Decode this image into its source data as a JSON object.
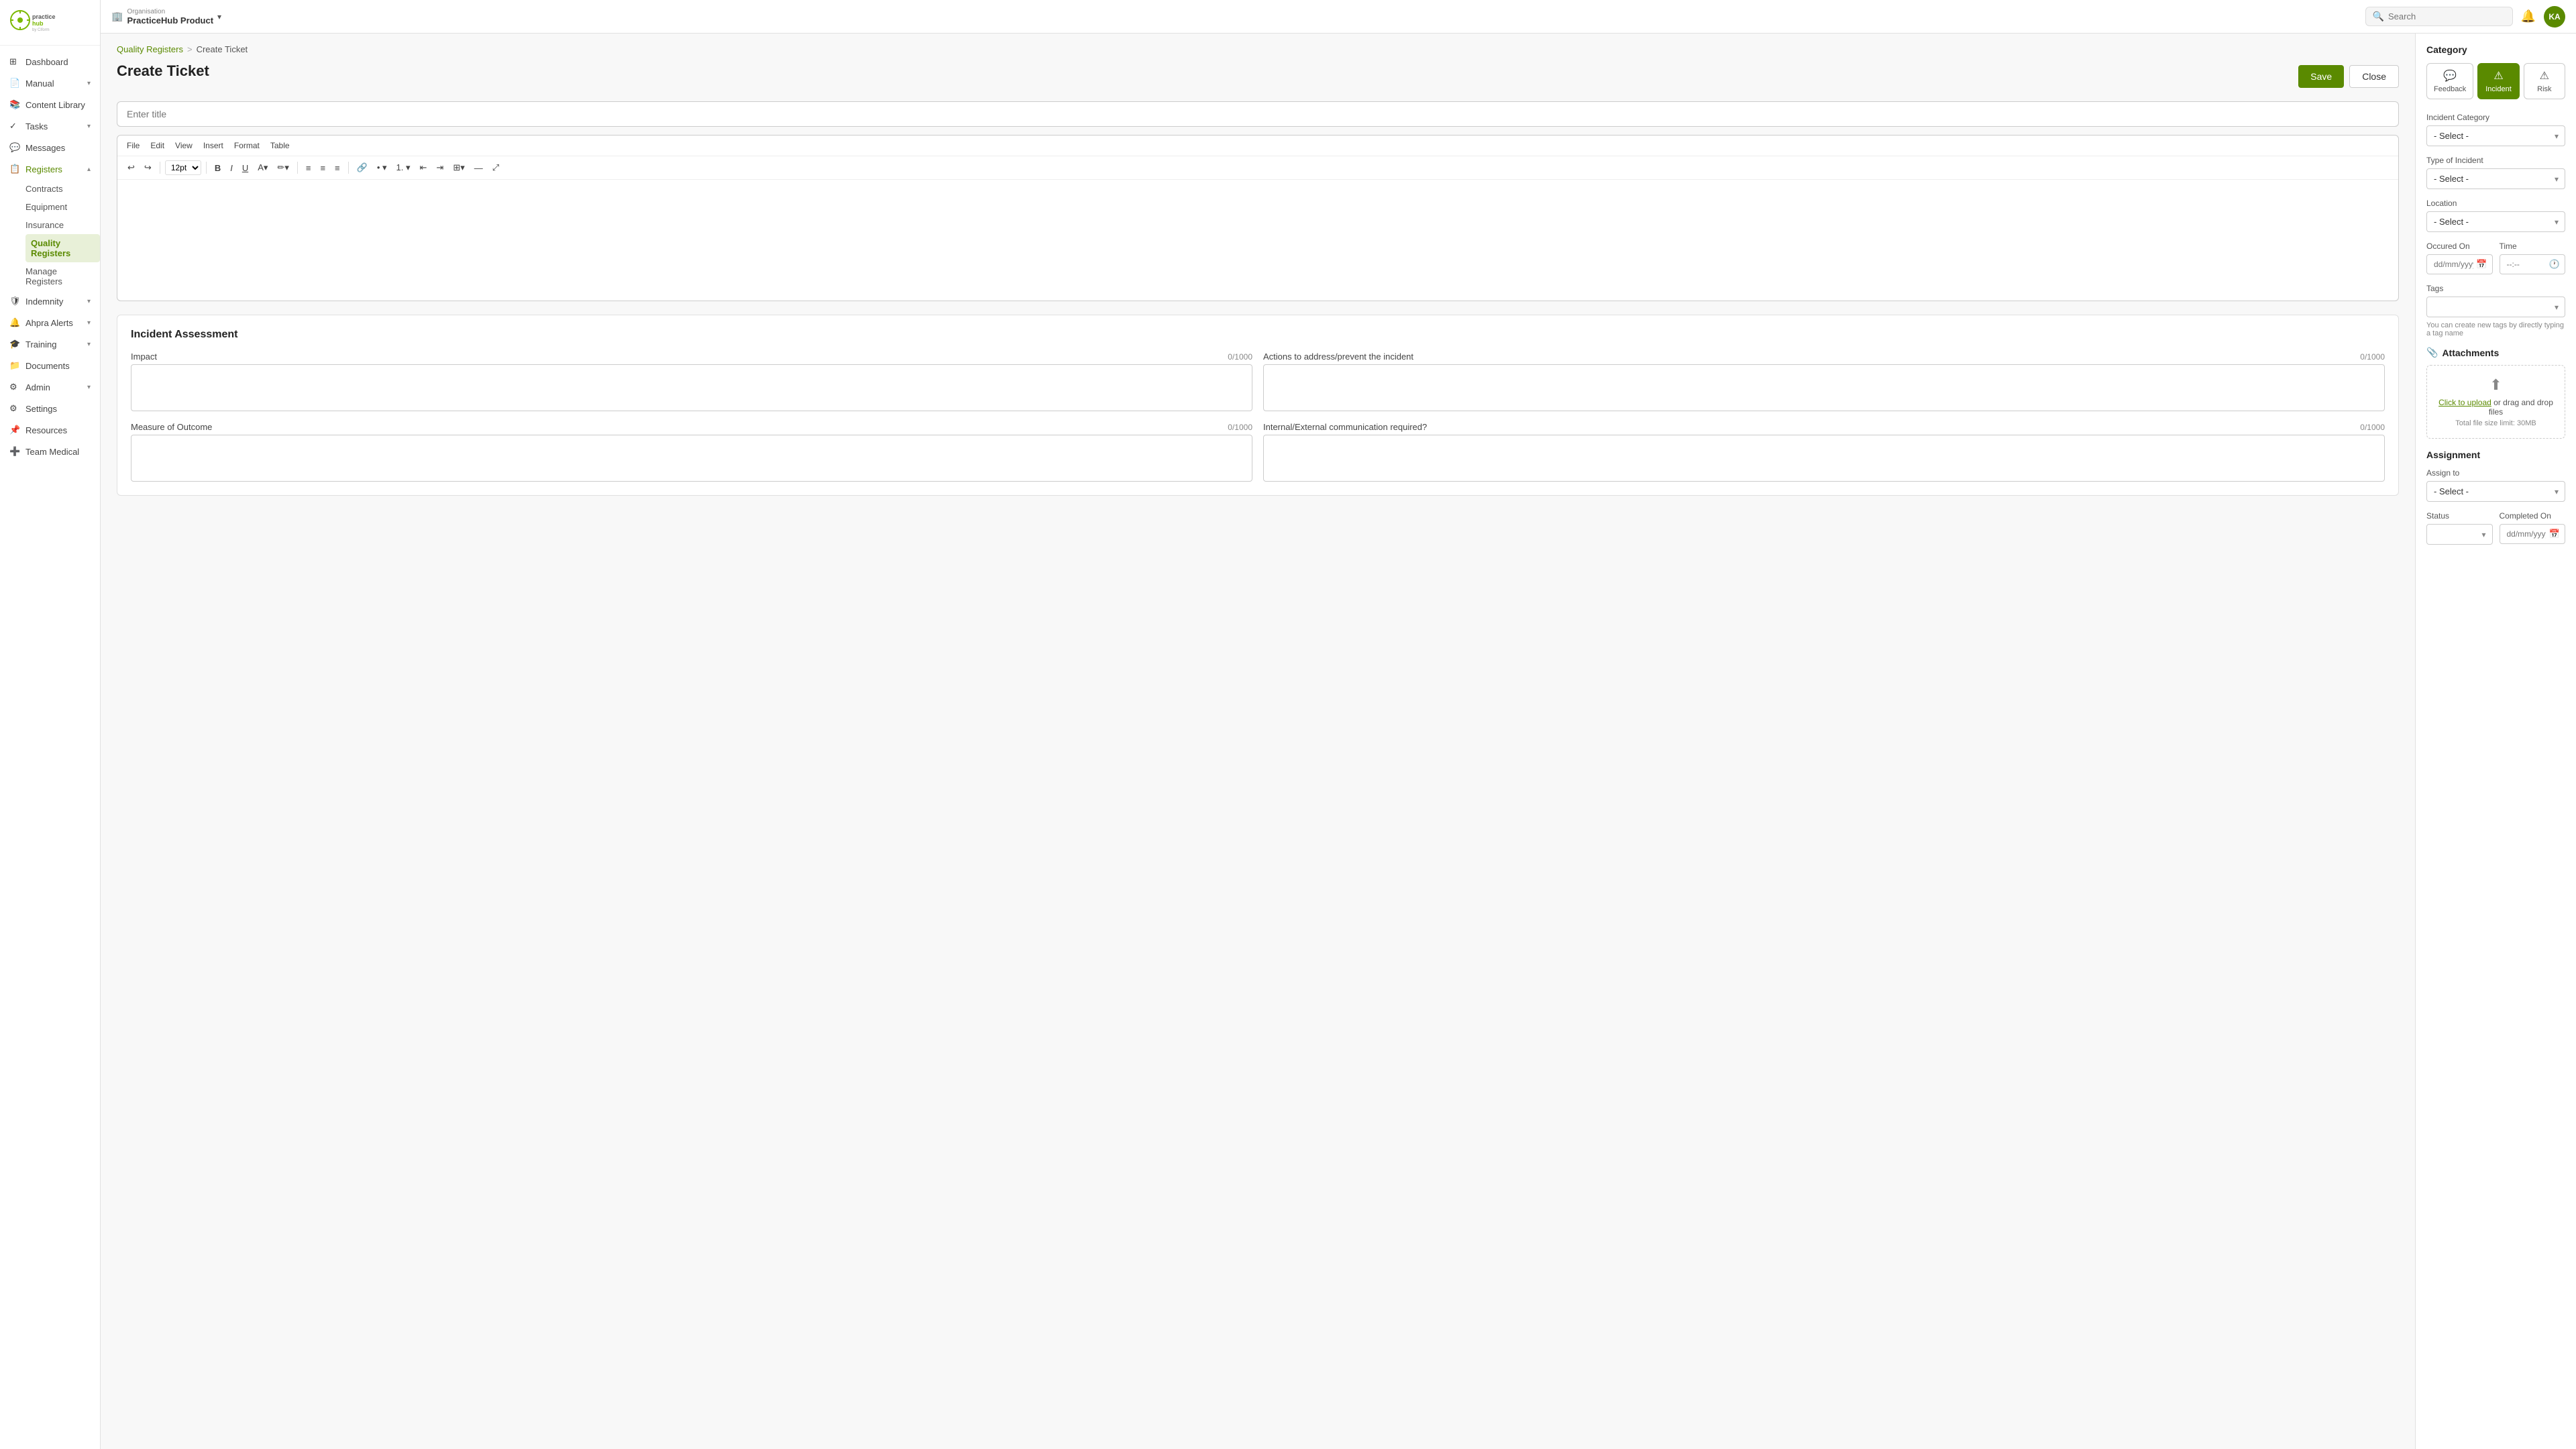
{
  "app": {
    "logo_text": "practicehub",
    "logo_subtitle": "by Ciform"
  },
  "topbar": {
    "org_label": "Organisation",
    "org_name": "PracticeHub Product",
    "search_placeholder": "Search",
    "avatar_initials": "KA"
  },
  "sidebar": {
    "items": [
      {
        "id": "dashboard",
        "label": "Dashboard",
        "icon": "⊞",
        "has_children": false
      },
      {
        "id": "manual",
        "label": "Manual",
        "icon": "📄",
        "has_children": true
      },
      {
        "id": "content-library",
        "label": "Content Library",
        "icon": "📚",
        "has_children": false
      },
      {
        "id": "tasks",
        "label": "Tasks",
        "icon": "✓",
        "has_children": true
      },
      {
        "id": "messages",
        "label": "Messages",
        "icon": "💬",
        "has_children": false
      },
      {
        "id": "registers",
        "label": "Registers",
        "icon": "📋",
        "has_children": true,
        "active": true
      },
      {
        "id": "indemnity",
        "label": "Indemnity",
        "icon": "🛡",
        "has_children": true
      },
      {
        "id": "ahpra-alerts",
        "label": "Ahpra Alerts",
        "icon": "🔔",
        "has_children": true
      },
      {
        "id": "training",
        "label": "Training",
        "icon": "🎓",
        "has_children": true
      },
      {
        "id": "documents",
        "label": "Documents",
        "icon": "📁",
        "has_children": false
      },
      {
        "id": "admin",
        "label": "Admin",
        "icon": "⚙",
        "has_children": true
      },
      {
        "id": "settings",
        "label": "Settings",
        "icon": "⚙",
        "has_children": false
      },
      {
        "id": "resources",
        "label": "Resources",
        "icon": "📌",
        "has_children": false
      },
      {
        "id": "team-medical",
        "label": "Team Medical",
        "icon": "➕",
        "has_children": false
      }
    ],
    "registers_sub": [
      {
        "id": "contracts",
        "label": "Contracts"
      },
      {
        "id": "equipment",
        "label": "Equipment"
      },
      {
        "id": "insurance",
        "label": "Insurance"
      },
      {
        "id": "quality-registers",
        "label": "Quality Registers",
        "active": true
      },
      {
        "id": "manage-registers",
        "label": "Manage Registers"
      }
    ]
  },
  "breadcrumb": {
    "parent": "Quality Registers",
    "separator": ">",
    "current": "Create Ticket"
  },
  "page": {
    "title": "Create Ticket",
    "save_label": "Save",
    "close_label": "Close"
  },
  "editor": {
    "title_placeholder": "Enter title",
    "menu_items": [
      "File",
      "Edit",
      "View",
      "Insert",
      "Format",
      "Table"
    ],
    "font_size": "12pt"
  },
  "assessment": {
    "title": "Incident Assessment",
    "fields": [
      {
        "id": "impact",
        "label": "Impact",
        "max": 1000,
        "current": 0
      },
      {
        "id": "actions",
        "label": "Actions to address/prevent the incident",
        "max": 1000,
        "current": 0
      },
      {
        "id": "measure",
        "label": "Measure of Outcome",
        "max": 1000,
        "current": 0
      },
      {
        "id": "communication",
        "label": "Internal/External communication required?",
        "max": 1000,
        "current": 0
      }
    ]
  },
  "right_panel": {
    "category_label": "Category",
    "category_tabs": [
      {
        "id": "feedback",
        "label": "Feedback",
        "icon": "💬"
      },
      {
        "id": "incident",
        "label": "Incident",
        "icon": "⚠",
        "active": true
      },
      {
        "id": "risk",
        "label": "Risk",
        "icon": "⚠"
      }
    ],
    "incident_category_label": "Incident Category",
    "incident_category_placeholder": "- Select -",
    "type_of_incident_label": "Type of Incident",
    "type_of_incident_placeholder": "- Select -",
    "location_label": "Location",
    "location_placeholder": "- Select -",
    "occurred_on_label": "Occured On",
    "occurred_on_placeholder": "dd/mm/yyyy",
    "time_label": "Time",
    "time_placeholder": "--:--",
    "tags_label": "Tags",
    "tags_hint": "You can create new tags by directly typing a tag name",
    "attachments_label": "Attachments",
    "upload_text": "Click to upload",
    "upload_suffix": " or drag and drop files",
    "upload_limit": "Total file size limit: 30MB",
    "assignment_label": "Assignment",
    "assign_to_label": "Assign to",
    "assign_to_placeholder": "- Select -",
    "status_label": "Status",
    "completed_on_label": "Completed On"
  }
}
